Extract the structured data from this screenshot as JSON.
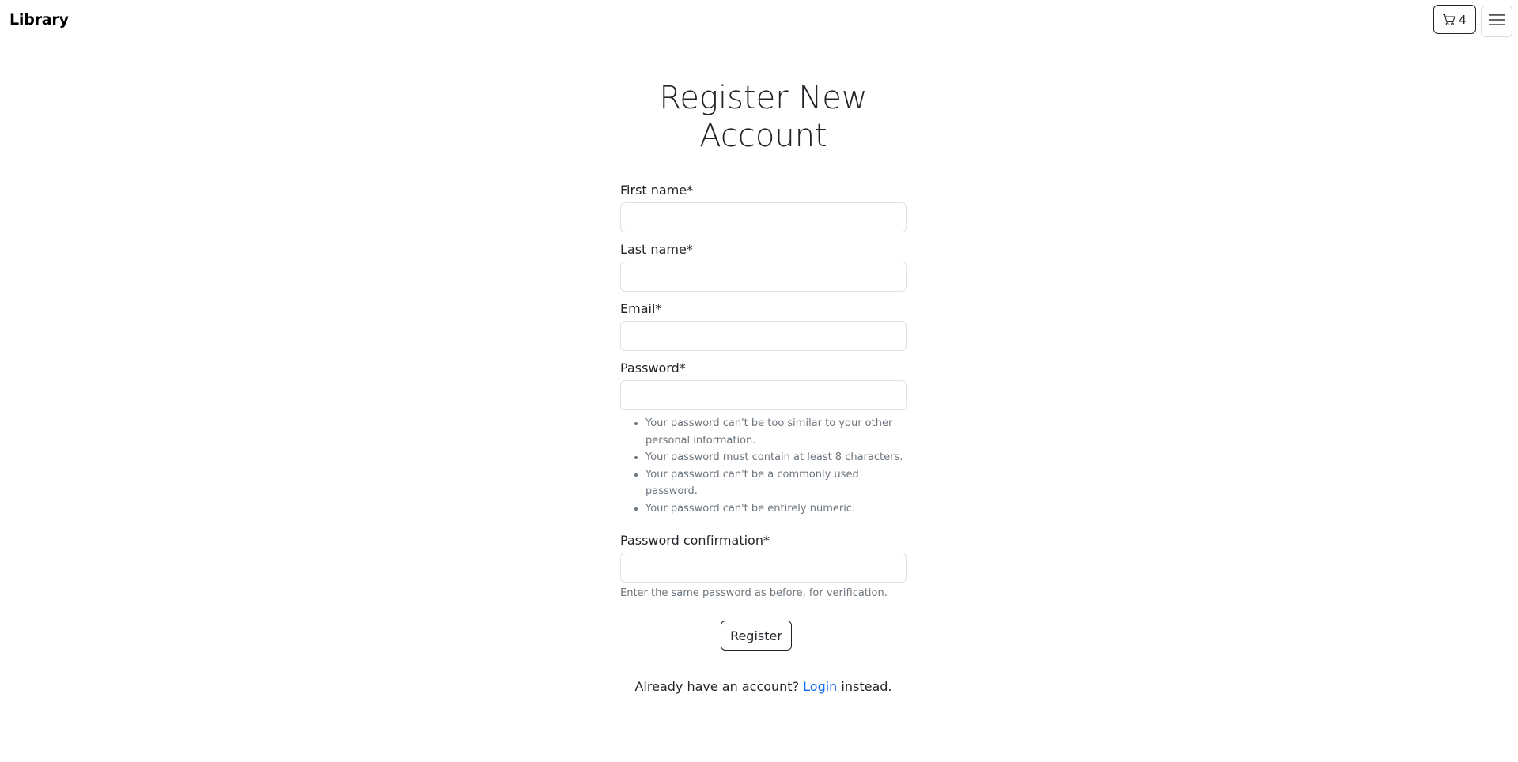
{
  "navbar": {
    "brand": "Library",
    "cart_count": "4",
    "cart_icon": "cart-icon",
    "menu_icon": "hamburger-icon"
  },
  "page": {
    "title": "Register New Account"
  },
  "form": {
    "first_name_label": "First name*",
    "last_name_label": "Last name*",
    "email_label": "Email*",
    "password_label": "Password*",
    "password_help": [
      "Your password can't be too similar to your other personal information.",
      "Your password must contain at least 8 characters.",
      "Your password can't be a commonly used password.",
      "Your password can't be entirely numeric."
    ],
    "password_confirmation_label": "Password confirmation*",
    "password_confirmation_help": "Enter the same password as before, for verification.",
    "submit_label": "Register"
  },
  "login_prompt": {
    "prefix": "Already have an account? ",
    "link": "Login",
    "suffix": " instead."
  },
  "colors": {
    "link": "#0d6efd",
    "text": "#212529",
    "muted": "#6c757d"
  }
}
